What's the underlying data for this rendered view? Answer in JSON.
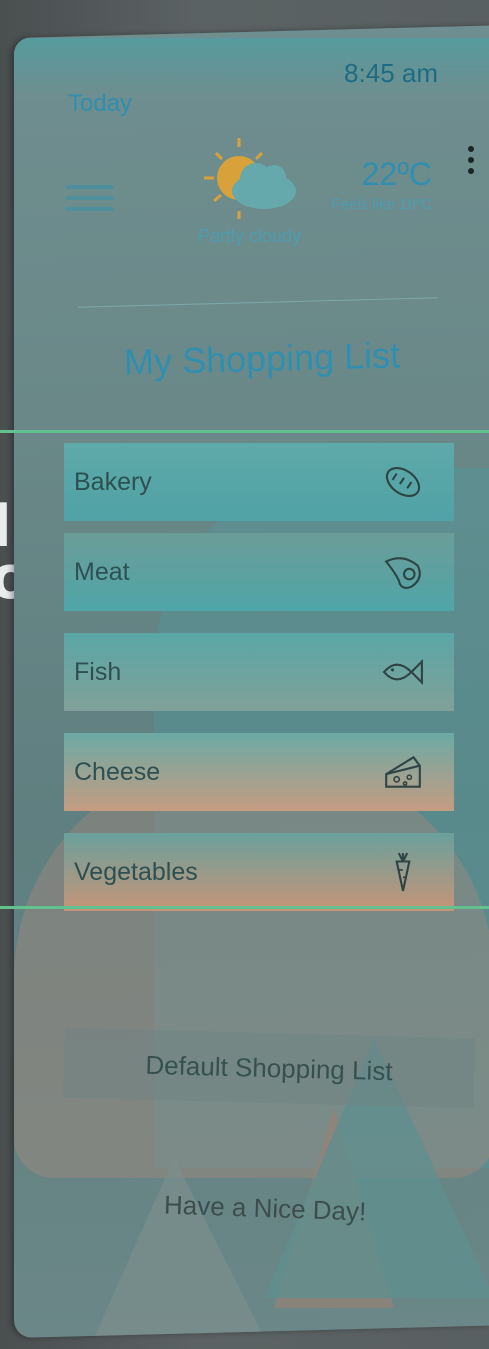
{
  "status": {
    "day": "Today",
    "time": "8:45 am"
  },
  "weather": {
    "condition": "Partly cloudy",
    "temperature": "22ºC",
    "feels_like": "Feels like 18ºC"
  },
  "page": {
    "title": "My Shopping List"
  },
  "categories": [
    {
      "label": "Bakery",
      "icon": "bread-icon"
    },
    {
      "label": "Meat",
      "icon": "steak-icon"
    },
    {
      "label": "Fish",
      "icon": "fish-icon"
    },
    {
      "label": "Cheese",
      "icon": "cheese-icon"
    },
    {
      "label": "Vegetables",
      "icon": "carrot-icon"
    }
  ],
  "actions": {
    "default_list": "Default Shopping List"
  },
  "footer": {
    "greeting": "Have a Nice Day!"
  },
  "colors": {
    "accent": "#2f8fb0",
    "highlight": "#63c08f"
  }
}
